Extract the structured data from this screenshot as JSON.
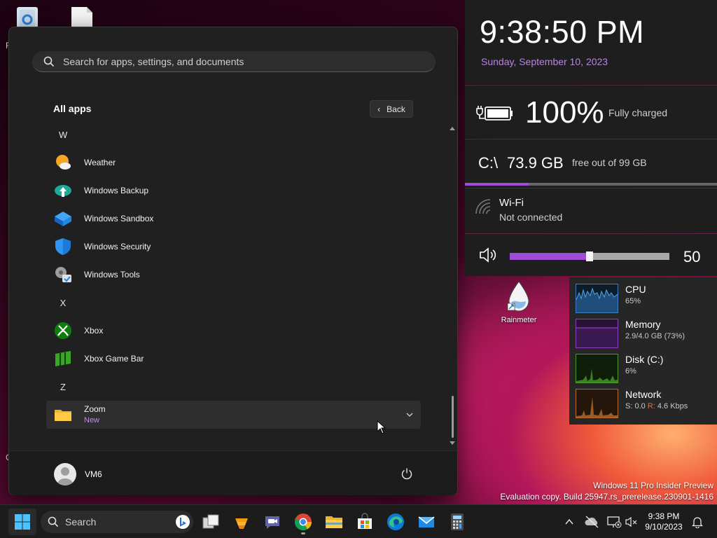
{
  "desktop": {
    "recycle_bin_partial_label": "R",
    "left_edge_char": "C",
    "rainmeter_label": "Rainmeter"
  },
  "start_menu": {
    "search_placeholder": "Search for apps, settings, and documents",
    "all_apps_title": "All apps",
    "back_label": "Back",
    "sections": [
      {
        "letter": "W",
        "apps": [
          "Weather",
          "Windows Backup",
          "Windows Sandbox",
          "Windows Security",
          "Windows Tools"
        ]
      },
      {
        "letter": "X",
        "apps": [
          "Xbox",
          "Xbox Game Bar"
        ]
      },
      {
        "letter": "Z",
        "apps": [
          "Zoom"
        ]
      }
    ],
    "zoom": {
      "label": "Zoom",
      "badge": "New"
    },
    "user_name": "VM6"
  },
  "rainmeter": {
    "clock": {
      "time": "9:38:50 PM",
      "date": "Sunday, September 10, 2023"
    },
    "battery": {
      "percent": "100%",
      "status": "Fully charged"
    },
    "disk": {
      "label": "C:\\",
      "free": "73.9 GB",
      "total_text": "free out of 99 GB",
      "used_fraction": 0.253
    },
    "wifi": {
      "title": "Wi-Fi",
      "status": "Not connected"
    },
    "volume": {
      "value": "50",
      "level": 0.5
    },
    "perf": [
      {
        "name": "CPU",
        "value": "65%",
        "color": "#3d7fc4"
      },
      {
        "name": "Memory",
        "value": "2.9/4.0 GB (73%)",
        "color": "#8d3fbf"
      },
      {
        "name": "Disk (C:)",
        "value": "6%",
        "color": "#4f9a2e"
      },
      {
        "name": "Network",
        "value_s": "S: 0.0 ",
        "value_r": "R:",
        "value_rest": " 4.6 Kbps",
        "color": "#b86a2a"
      }
    ]
  },
  "watermark": {
    "line1": "Windows 11 Pro Insider Preview",
    "line2": "Evaluation copy. Build 25947.rs_prerelease.230901-1416"
  },
  "taskbar": {
    "search_label": "Search",
    "time": "9:38 PM",
    "date": "9/10/2023"
  },
  "colors": {
    "accent": "#a04cd6",
    "date_purple": "#b884e0"
  }
}
